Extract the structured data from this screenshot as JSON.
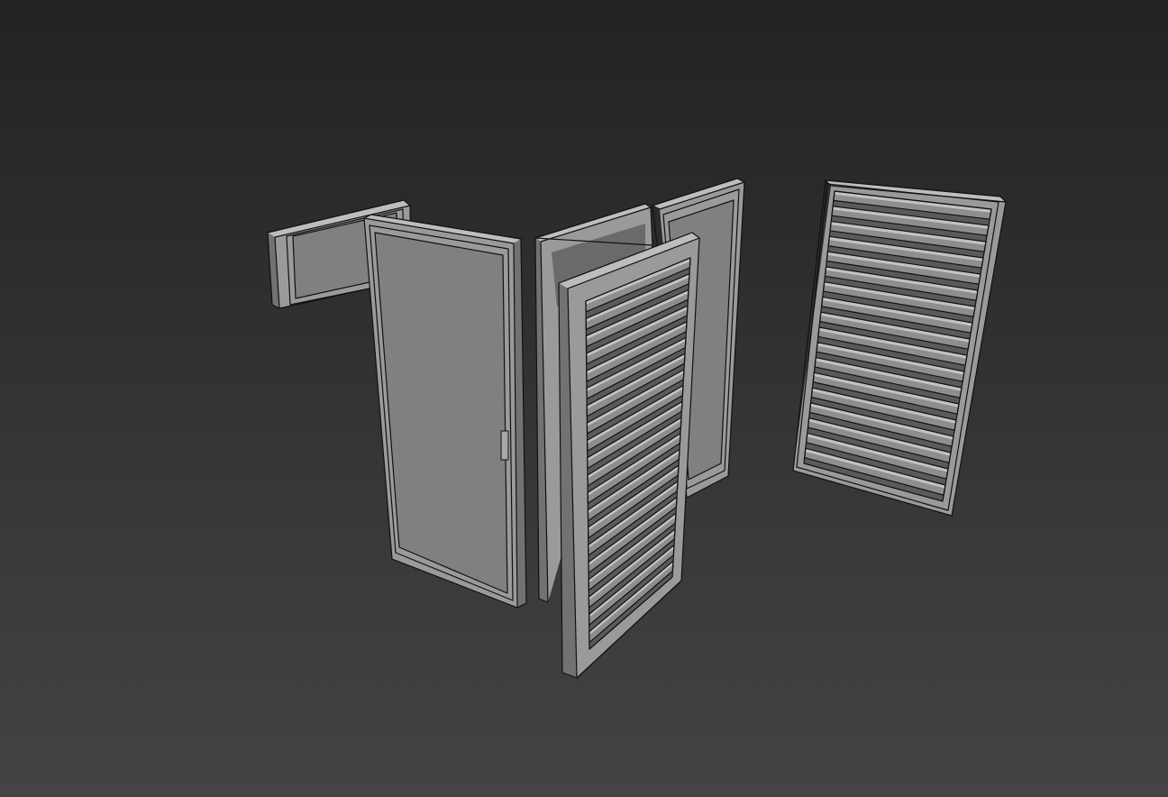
{
  "viewport": {
    "background_top": "#222222",
    "background_bottom": "#444444"
  },
  "scene": {
    "objects": [
      {
        "name": "transom-window",
        "kind": "glazed panel"
      },
      {
        "name": "glazed-door-open",
        "kind": "glazed door"
      },
      {
        "name": "double-glazed-frame",
        "kind": "double glazed frame"
      },
      {
        "name": "louvered-shutter-front",
        "kind": "louvered shutter"
      },
      {
        "name": "louvered-shutter-right",
        "kind": "louvered shutter"
      }
    ],
    "colors": {
      "frame": "#9a9a9a",
      "glass": "#808080",
      "outline": "#111111"
    }
  }
}
